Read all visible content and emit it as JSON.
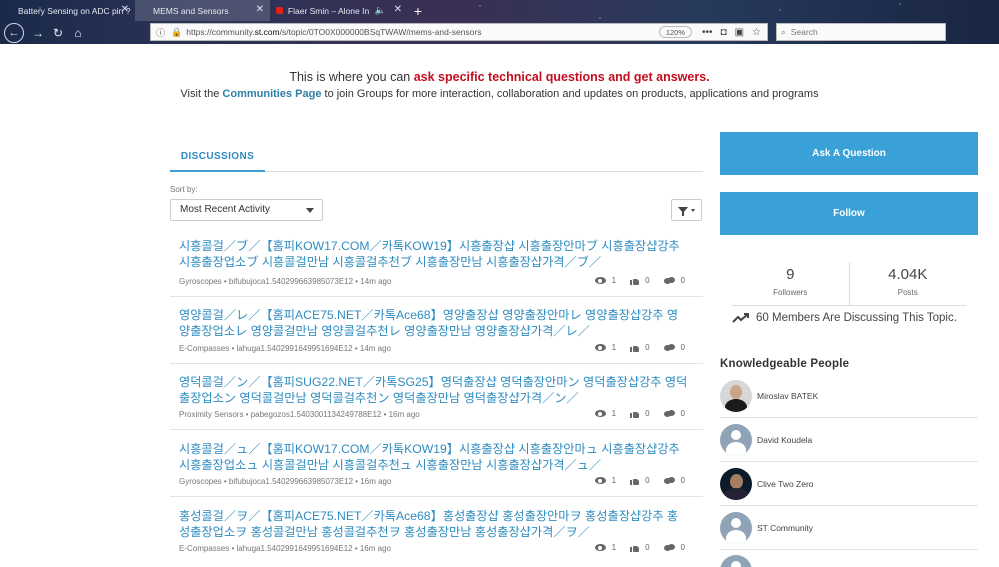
{
  "browser": {
    "tabs": [
      {
        "label": "Battery Sensing on ADC pin ?",
        "active": false
      },
      {
        "label": "MEMS and Sensors",
        "active": true
      },
      {
        "label": "Flaer Smin – Alone In The D",
        "active": false
      }
    ],
    "url_prefix": "https://community.",
    "url_domain": "st.com",
    "url_rest": "/s/topic/0TO0X000000BSqTWAW/mems-and-sensors",
    "zoom": "120%",
    "search_placeholder": "Search"
  },
  "banner": {
    "line1_pre": "This is where you can ",
    "line1_highlight": "ask specific technical questions and get answers.",
    "line2_pre": "Visit the ",
    "line2_link": "Communities Page",
    "line2_post": " to join Groups for more interaction, collaboration and updates on products, applications and programs"
  },
  "discussions": {
    "tab_label": "DISCUSSIONS",
    "sort_label": "Sort by:",
    "sort_value": "Most Recent Activity",
    "posts": [
      {
        "title": "시흥콜걸／ブ／【홈피KOW17.COM／카톡KOW19】시흥출장샵 시흥출장안마ブ 시흥출장샵강추 시흥출장업소ブ 시흥콜걸만남 시흥콜걸추천ブ 시흥출장만남 시흥출장샵가격／ブ／",
        "meta": "Gyroscopes • bifubujoca1.540299663985073E12 • 14m ago",
        "views": "1",
        "likes": "0",
        "comments": "0"
      },
      {
        "title": "영양콜걸／レ／【홈피ACE75.NET／카톡Ace68】영양출장샵 영양출장안마レ 영양출장샵강추 영양출장업소レ 영양콜걸만남 영양콜걸추천レ 영양출장만남 영양출장샵가격／レ／",
        "meta": "E-Compasses • lahuga1.5402991649951694E12 • 14m ago",
        "views": "1",
        "likes": "0",
        "comments": "0"
      },
      {
        "title": "영덕콜걸／ン／【홈피SUG22.NET／카톡SG25】영덕출장샵 영덕출장안마ン 영덕출장샵강추 영덕출장업소ン 영덕콜걸만남 영덕콜걸추천ン 영덕출장만남 영덕출장샵가격／ン／",
        "meta": "Proximity Sensors • pabegozos1.5403001134249788E12 • 16m ago",
        "views": "1",
        "likes": "0",
        "comments": "0"
      },
      {
        "title": "시흥콜걸／ュ／【홈피KOW17.COM／카톡KOW19】시흥출장샵 시흥출장안마ュ 시흥출장샵강추 시흥출장업소ュ 시흥콜걸만남 시흥콜걸추천ュ 시흥출장만남 시흥출장샵가격／ュ／",
        "meta": "Gyroscopes • bifubujoca1.540299663985073E12 • 16m ago",
        "views": "1",
        "likes": "0",
        "comments": "0"
      },
      {
        "title": "홍성콜걸／ヲ／【홈피ACE75.NET／카톡Ace68】홍성출장샵 홍성출장안마ヲ 홍성출장샵강추 홍성출장업소ヲ 홍성콜걸만남 홍성콜걸추천ヲ 홍성출장만남 홍성출장샵가격／ヲ／",
        "meta": "E-Compasses • lahuga1.5402991649951694E12 • 16m ago",
        "views": "1",
        "likes": "0",
        "comments": "0"
      }
    ]
  },
  "sidebar": {
    "ask_button": "Ask A Question",
    "follow_button": "Follow",
    "followers_count": "9",
    "followers_label": "Followers",
    "posts_count": "4.04K",
    "posts_label": "Posts",
    "members_text": "60 Members Are Discussing This Topic.",
    "kp_title": "Knowledgeable People",
    "people": [
      {
        "name": "Miroslav BATEK"
      },
      {
        "name": "David Koudela"
      },
      {
        "name": "Clive Two Zero"
      },
      {
        "name": "ST Community"
      }
    ]
  }
}
